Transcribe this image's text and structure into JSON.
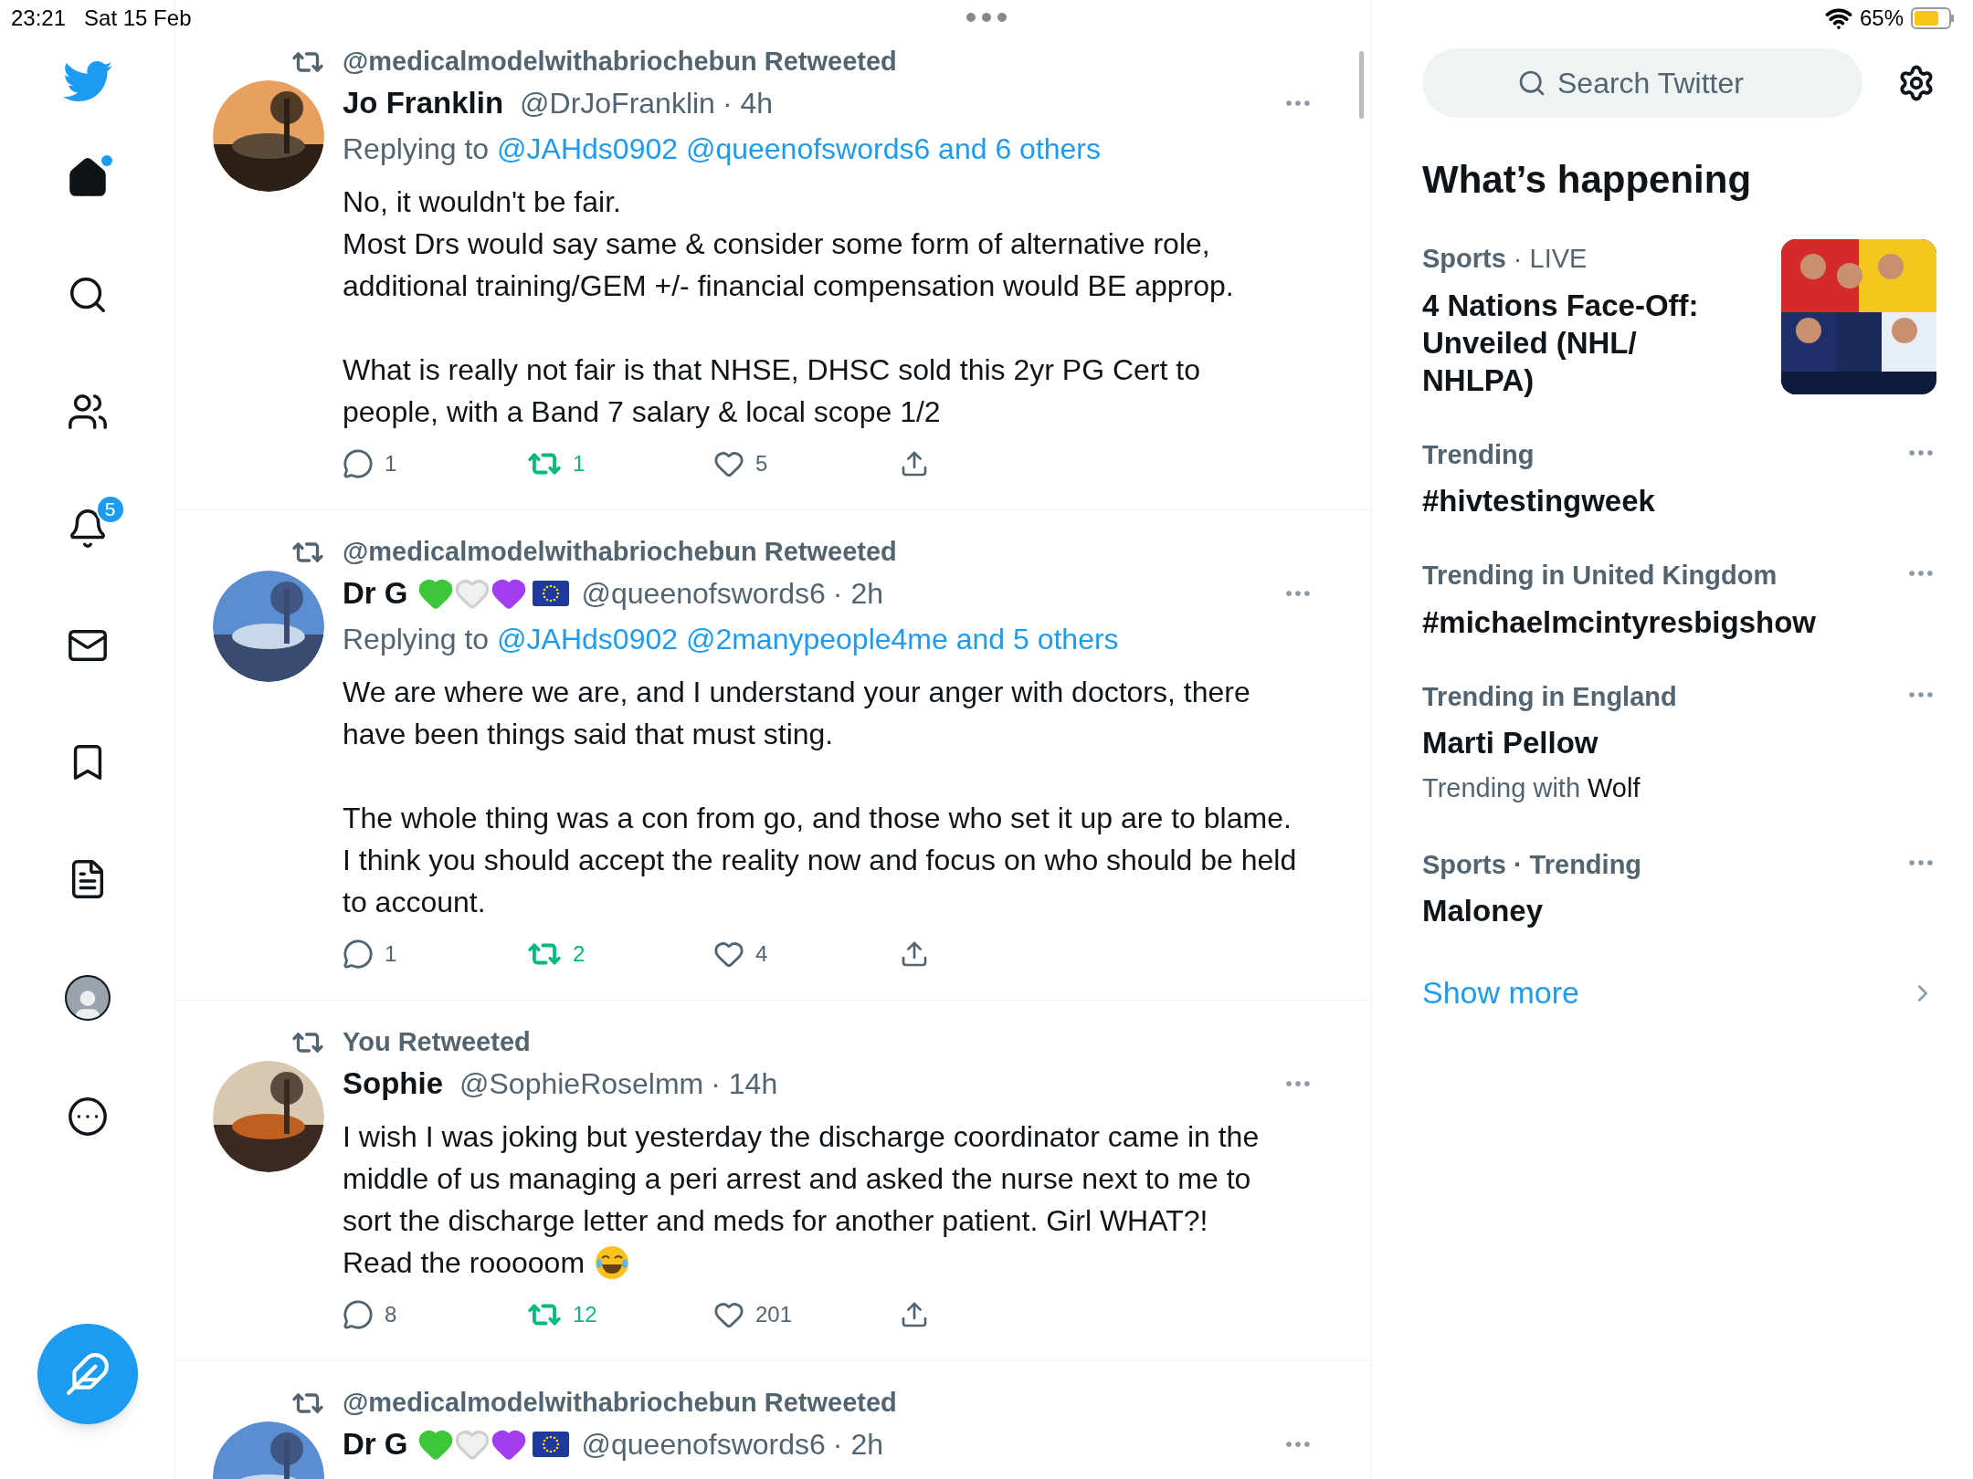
{
  "status_bar": {
    "time": "23:21",
    "date": "Sat 15 Feb",
    "battery": "65%"
  },
  "nav": {
    "items": [
      {
        "kind": "home",
        "dot": true
      },
      {
        "kind": "search"
      },
      {
        "kind": "communities"
      },
      {
        "kind": "notifications",
        "badge": "5"
      },
      {
        "kind": "messages"
      },
      {
        "kind": "bookmarks"
      },
      {
        "kind": "lists"
      },
      {
        "kind": "profile"
      },
      {
        "kind": "more"
      }
    ]
  },
  "tweets": [
    {
      "context": "@medicalmodelwithabriochebun Retweeted",
      "name": "Jo Franklin",
      "handle": "@DrJoFranklin",
      "time": "· 4h",
      "replying_prefix": "Replying to",
      "replying_to": "@JAHds0902 @queenofswords6 and 6 others",
      "body": [
        {
          "text": "No, it wouldn't be fair.\nMost Drs would say same & consider some form of alternative role, additional training/GEM +/- financial compensation would BE approp."
        },
        {
          "text": "What is really not fair is that NHSE, DHSC sold this 2yr PG Cert to people, with a Band 7 salary & local scope 1/2"
        }
      ],
      "replies": "1",
      "retweets": "1",
      "retweeted": true,
      "likes": "5",
      "liked": false
    },
    {
      "context": "@medicalmodelwithabriochebun Retweeted",
      "name": "Dr G",
      "badges": [
        {
          "kind": "heart",
          "color": "#3fc53a"
        },
        {
          "kind": "heart",
          "color": "#f0f0f0"
        },
        {
          "kind": "heart",
          "color": "#a23ef0"
        },
        {
          "kind": "flag"
        }
      ],
      "handle": "@queenofswords6",
      "time": "· 2h",
      "replying_prefix": "Replying to",
      "replying_to": "@JAHds0902 @2manypeople4me and 5 others",
      "body": [
        {
          "text": "We are where we are, and I understand your anger with doctors, there have been things said that must sting."
        },
        {
          "text": "The whole thing was a con from go, and those who set it up are to blame. I think you should accept the reality now and focus on who should be held to account."
        }
      ],
      "replies": "1",
      "retweets": "2",
      "retweeted": true,
      "likes": "4",
      "liked": false
    },
    {
      "context": "You Retweeted",
      "name": "Sophie",
      "handle": "@SophieRoselmm",
      "time": "· 14h",
      "body": [
        {
          "text": "I wish I was joking but yesterday the discharge coordinator came in the middle of us managing a peri arrest and asked the nurse next to me to sort the discharge letter and meds for another patient. Girl WHAT?!",
          "kind": "paragraph"
        },
        {
          "text": "Read the rooooom",
          "kind": "line_with_laughing_emoji"
        }
      ],
      "replies": "8",
      "retweets": "12",
      "retweeted": true,
      "likes": "201",
      "liked": false
    },
    {
      "context": "@medicalmodelwithabriochebun Retweeted",
      "name": "Dr G",
      "badges": [
        {
          "kind": "heart",
          "color": "#3fc53a"
        },
        {
          "kind": "heart",
          "color": "#f0f0f0"
        },
        {
          "kind": "heart",
          "color": "#a23ef0"
        },
        {
          "kind": "flag"
        }
      ],
      "handle": "@queenofswords6",
      "time": "· 2h"
    }
  ],
  "sidebar": {
    "search_placeholder": "Search Twitter",
    "heading": "What’s happening",
    "trends": [
      {
        "kind": "picture",
        "category": "Sports",
        "meta": "· LIVE",
        "title": "4 Nations Face-Off: Unveiled (NHL/ NHLPA)"
      },
      {
        "kind": "trend",
        "category": "Trending",
        "title": "#hivtestingweek"
      },
      {
        "kind": "trend",
        "category": "Trending in United Kingdom",
        "title": "#michaelmcintyresbigshow"
      },
      {
        "kind": "trend",
        "category": "Trending in England",
        "title": "Marti Pellow",
        "note_prefix": "Trending with",
        "note": "Wolf"
      },
      {
        "kind": "trend",
        "category": "Sports · Trending",
        "title": "Maloney"
      }
    ],
    "show_more": "Show more"
  }
}
